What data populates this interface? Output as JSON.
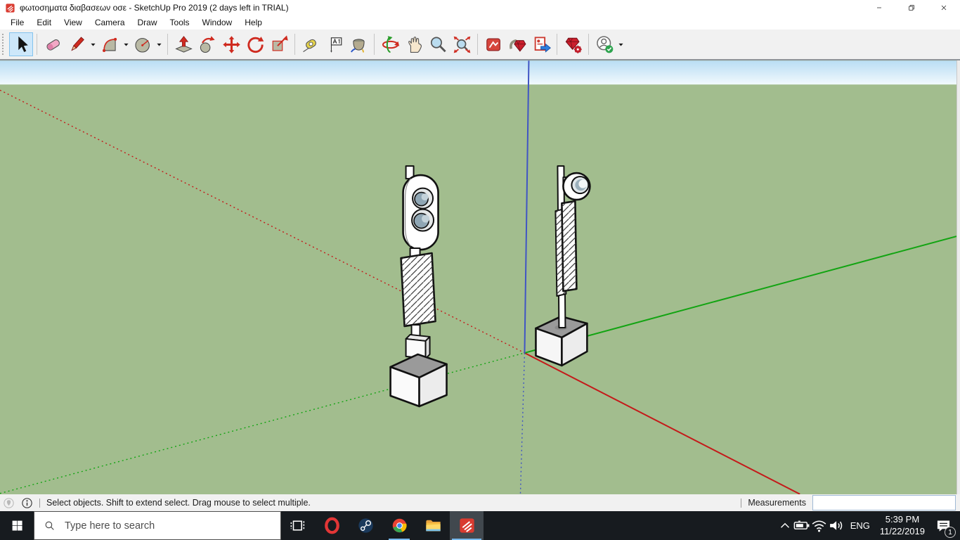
{
  "window": {
    "title": "φωτοσηματα διαβασεων οσε - SketchUp Pro 2019 (2 days left in TRIAL)"
  },
  "menubar": {
    "items": [
      "File",
      "Edit",
      "View",
      "Camera",
      "Draw",
      "Tools",
      "Window",
      "Help"
    ]
  },
  "toolbar": {
    "items": [
      {
        "icon": "select-icon",
        "label": "select",
        "selected": true
      },
      {
        "sep": true
      },
      {
        "icon": "eraser-icon",
        "label": "eraser"
      },
      {
        "icon": "line-icon",
        "label": "line",
        "dropdown": true
      },
      {
        "icon": "arc-icon",
        "label": "arcs",
        "dropdown": true
      },
      {
        "icon": "shapes-icon",
        "label": "shapes",
        "dropdown": true
      },
      {
        "sep": true
      },
      {
        "icon": "pushpull-icon",
        "label": "push-pull"
      },
      {
        "icon": "followme-icon",
        "label": "follow-me"
      },
      {
        "icon": "move-icon",
        "label": "move"
      },
      {
        "icon": "rotate-icon",
        "label": "rotate"
      },
      {
        "icon": "scale-icon",
        "label": "scale"
      },
      {
        "sep": true
      },
      {
        "icon": "tape-icon",
        "label": "tape-measure"
      },
      {
        "icon": "text-icon",
        "label": "text"
      },
      {
        "icon": "paint-icon",
        "label": "paint-bucket"
      },
      {
        "sep": true
      },
      {
        "icon": "orbit-icon",
        "label": "orbit"
      },
      {
        "icon": "pan-icon",
        "label": "pan"
      },
      {
        "icon": "zoom-icon",
        "label": "zoom"
      },
      {
        "icon": "zoomext-icon",
        "label": "zoom-extents"
      },
      {
        "sep": true
      },
      {
        "icon": "wh3d-icon",
        "label": "3d-warehouse"
      },
      {
        "icon": "extwh-icon",
        "label": "extension-warehouse"
      },
      {
        "icon": "share-icon",
        "label": "share-model"
      },
      {
        "sep": true
      },
      {
        "icon": "extmgr-icon",
        "label": "extension-manager"
      },
      {
        "sep": true
      },
      {
        "icon": "account-icon",
        "label": "account",
        "dropdown": true
      }
    ]
  },
  "statusbar": {
    "help_text": "Select objects. Shift to extend select. Drag mouse to select multiple.",
    "measurements_label": "Measurements",
    "measurements_value": ""
  },
  "taskbar": {
    "search_placeholder": "Type here to search",
    "apps": [
      {
        "icon": "taskview-icon",
        "name": "task-view"
      },
      {
        "icon": "opera-icon",
        "name": "opera"
      },
      {
        "icon": "steam-icon",
        "name": "steam"
      },
      {
        "icon": "chrome-icon",
        "name": "chrome",
        "open": true
      },
      {
        "icon": "explorer-icon",
        "name": "file-explorer"
      },
      {
        "icon": "sketchup-icon",
        "name": "sketchup",
        "open": true,
        "active": true
      }
    ],
    "tray": {
      "language": "ENG",
      "time": "5:39 PM",
      "date": "11/22/2019",
      "notification_count": "1"
    }
  },
  "viewport": {
    "colors": {
      "sky_top": "#b9ddf4",
      "sky_horizon": "#f3fafd",
      "ground": "#a2bd8e",
      "axis_red": "#c41a1a",
      "axis_green": "#12a412",
      "axis_blue": "#4055c4"
    }
  }
}
